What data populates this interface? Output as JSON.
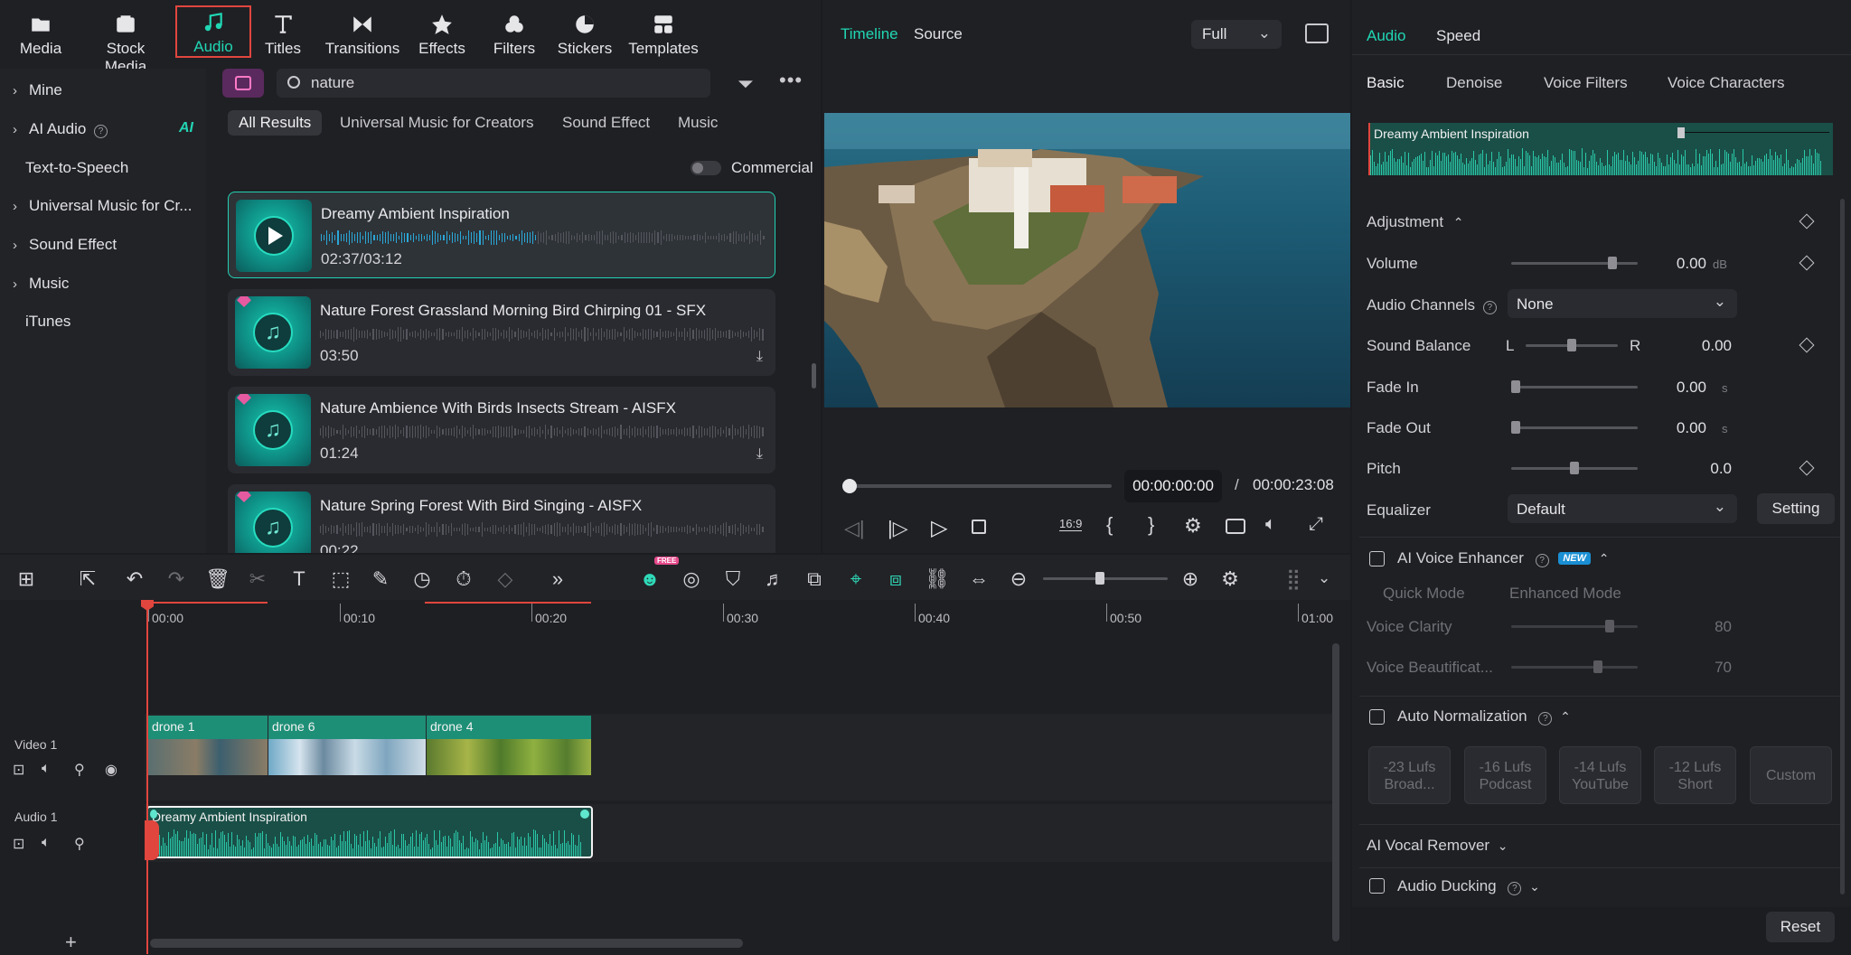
{
  "toolbar": {
    "items": [
      {
        "label": "Media",
        "icon": "media-icon"
      },
      {
        "label": "Stock Media",
        "icon": "stock-media-icon"
      },
      {
        "label": "Audio",
        "icon": "music-note-icon",
        "selected": true
      },
      {
        "label": "Titles",
        "icon": "titles-icon"
      },
      {
        "label": "Transitions",
        "icon": "transitions-icon"
      },
      {
        "label": "Effects",
        "icon": "effects-icon"
      },
      {
        "label": "Filters",
        "icon": "filters-icon"
      },
      {
        "label": "Stickers",
        "icon": "stickers-icon"
      },
      {
        "label": "Templates",
        "icon": "templates-icon"
      }
    ]
  },
  "sidebar": {
    "items": [
      {
        "label": "Mine",
        "expandable": true
      },
      {
        "label": "AI Audio",
        "expandable": true,
        "badge": "AI"
      },
      {
        "label": "Text-to-Speech",
        "expandable": false
      },
      {
        "label": "Universal Music for Cr...",
        "expandable": true
      },
      {
        "label": "Sound Effect",
        "expandable": true
      },
      {
        "label": "Music",
        "expandable": true
      },
      {
        "label": "iTunes",
        "expandable": false
      }
    ]
  },
  "library": {
    "search_value": "nature",
    "tabs": [
      "All Results",
      "Universal Music for Creators",
      "Sound Effect",
      "Music"
    ],
    "active_tab": "All Results",
    "commercial_label": "Commercial",
    "commercial_on": false,
    "items": [
      {
        "title": "Dreamy Ambient Inspiration",
        "time": "02:37/03:12",
        "selected": true,
        "premium": false,
        "playing": true
      },
      {
        "title": "Nature Forest Grassland Morning Bird Chirping 01 - SFX",
        "time": "03:50",
        "premium": true
      },
      {
        "title": "Nature Ambience With Birds Insects Stream - AISFX",
        "time": "01:24",
        "premium": true
      },
      {
        "title": "Nature Spring Forest With Bird Singing - AISFX",
        "time": "00:22",
        "premium": true
      }
    ]
  },
  "preview": {
    "tabs": [
      "Timeline",
      "Source"
    ],
    "active_tab": "Timeline",
    "quality": "Full",
    "current_time": "00:00:00:00",
    "separator": "/",
    "total_time": "00:00:23:08",
    "playhead_fraction": 0.0,
    "ratio_label": "16:9"
  },
  "timeline": {
    "ruler": [
      "00:00",
      "00:10",
      "00:20",
      "00:30",
      "00:40",
      "00:50",
      "01:00"
    ],
    "zoom_level_fraction": 0.45,
    "promo_badge": "FREE",
    "tracks": [
      {
        "name": "Video 1",
        "clips": [
          {
            "label": "drone 1"
          },
          {
            "label": "drone 6"
          },
          {
            "label": "drone 4"
          }
        ]
      },
      {
        "name": "Audio 1",
        "clips": [
          {
            "label": "Dreamy Ambient Inspiration"
          }
        ]
      }
    ]
  },
  "properties": {
    "top_tabs": [
      "Audio",
      "Speed"
    ],
    "active_top": "Audio",
    "sub_tabs": [
      "Basic",
      "Denoise",
      "Voice Filters",
      "Voice Characters"
    ],
    "active_sub": "Basic",
    "clip_name": "Dreamy Ambient Inspiration",
    "adjustment_label": "Adjustment",
    "volume": {
      "label": "Volume",
      "value": "0.00",
      "unit": "dB",
      "level": 0.82
    },
    "audio_channels": {
      "label": "Audio Channels",
      "value": "None"
    },
    "sound_balance": {
      "label": "Sound Balance",
      "left": "L",
      "right": "R",
      "value": "0.00",
      "level": 0.5
    },
    "fade_in": {
      "label": "Fade In",
      "value": "0.00",
      "unit": "s",
      "level": 0.0
    },
    "fade_out": {
      "label": "Fade Out",
      "value": "0.00",
      "unit": "s",
      "level": 0.0
    },
    "pitch": {
      "label": "Pitch",
      "value": "0.0",
      "level": 0.5
    },
    "equalizer": {
      "label": "Equalizer",
      "value": "Default",
      "setting": "Setting"
    },
    "ai_voice_enhancer": {
      "label": "AI Voice Enhancer",
      "badge": "NEW",
      "modes": [
        "Quick Mode",
        "Enhanced Mode"
      ],
      "voice_clarity": {
        "label": "Voice Clarity",
        "value": "80",
        "level": 0.8
      },
      "voice_beautification": {
        "label": "Voice Beautificat...",
        "value": "70",
        "level": 0.7
      }
    },
    "auto_normalization": {
      "label": "Auto Normalization",
      "presets": [
        [
          "-23 Lufs",
          "Broad..."
        ],
        [
          "-16 Lufs",
          "Podcast"
        ],
        [
          "-14 Lufs",
          "YouTube"
        ],
        [
          "-12 Lufs",
          "Short"
        ],
        [
          "Custom",
          ""
        ]
      ]
    },
    "ai_vocal_remover": "AI Vocal Remover",
    "audio_ducking": "Audio Ducking",
    "reset": "Reset"
  },
  "colors": {
    "accent": "#20d7b4",
    "selection_red": "#e0463e",
    "clip_green": "#1e8f77"
  }
}
